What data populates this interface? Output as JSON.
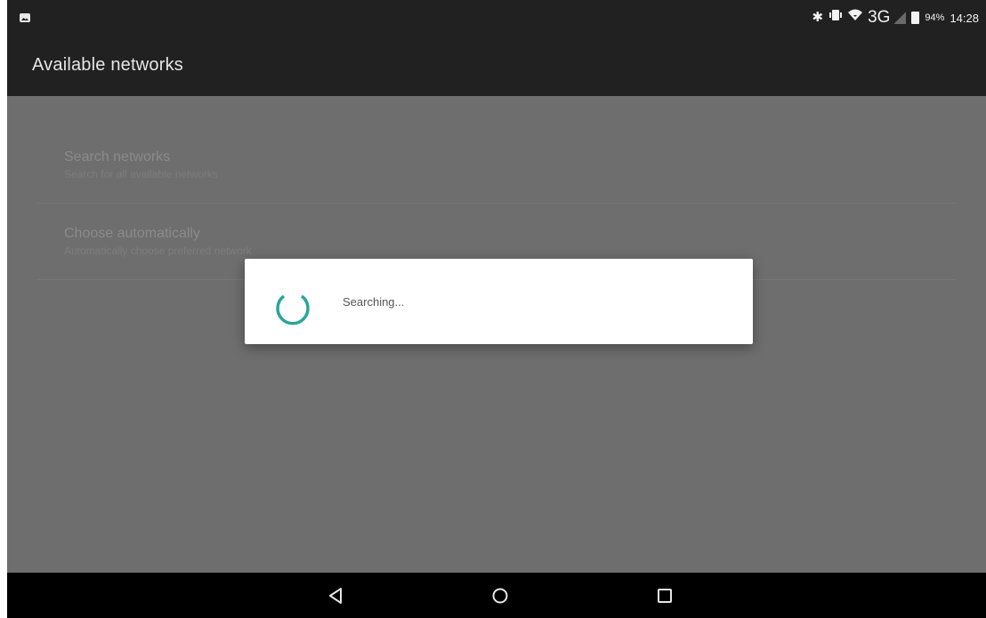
{
  "status_bar": {
    "network_type": "3G",
    "battery_percent": "94%",
    "clock": "14:28",
    "icons": [
      "image-notification-icon",
      "bluetooth-icon",
      "vibrate-icon",
      "wifi-icon",
      "signal-icon",
      "battery-icon"
    ]
  },
  "header": {
    "title": "Available networks"
  },
  "preferences": [
    {
      "title": "Search networks",
      "summary": "Search for all available networks"
    },
    {
      "title": "Choose automatically",
      "summary": "Automatically choose preferred network"
    }
  ],
  "dialog": {
    "message": "Searching...",
    "spinner_color": "#26a69a"
  },
  "nav_bar": {
    "icons": [
      "back-icon",
      "home-icon",
      "recents-icon"
    ]
  }
}
